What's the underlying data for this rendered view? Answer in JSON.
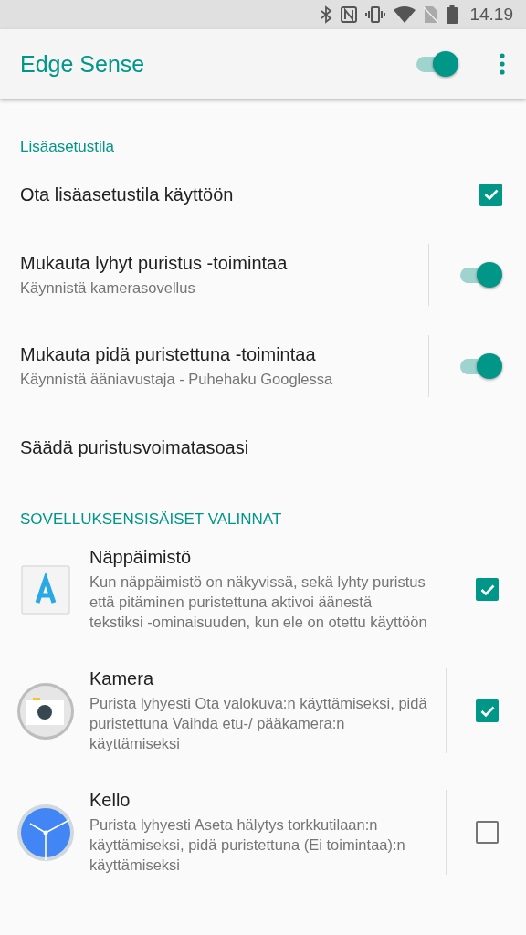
{
  "status_bar": {
    "time": "14.19"
  },
  "app_bar": {
    "title": "Edge Sense",
    "master_switch_on": true
  },
  "sections": [
    {
      "title": "Lisäasetustila",
      "items": [
        {
          "kind": "checkbox",
          "title": "Ota lisäasetustila käyttöön",
          "checked": true
        },
        {
          "kind": "switch",
          "title": "Mukauta lyhyt puristus -toimintaa",
          "subtitle": "Käynnistä kamerasovellus",
          "on": true
        },
        {
          "kind": "switch",
          "title": "Mukauta pidä puristettuna -toimintaa",
          "subtitle": "Käynnistä ääniavustaja - Puhehaku Googlessa",
          "on": true
        },
        {
          "kind": "plain",
          "title": "Säädä puristusvoimatasoasi"
        }
      ]
    },
    {
      "title": "SOVELLUKSENSISÄISET VALINNAT",
      "items": [
        {
          "kind": "app",
          "title": "Näppäimistö",
          "subtitle": "Kun näppäimistö on näkyvissä, sekä lyhty puristus että pitäminen puristettuna aktivoi äänestä tekstiksi -ominaisuuden, kun ele on otettu käyttöön",
          "checked": true,
          "divider": false
        },
        {
          "kind": "app",
          "title": "Kamera",
          "subtitle": "Purista lyhyesti Ota valokuva:n käyttämiseksi, pidä puristettuna Vaihda etu-/ pääkamera:n käyttämiseksi",
          "checked": true,
          "divider": true
        },
        {
          "kind": "app",
          "title": "Kello",
          "subtitle": "Purista lyhyesti Aseta hälytys torkkutilaan:n käyttämiseksi, pidä puristettuna (Ei toimintaa):n käyttämiseksi",
          "checked": false,
          "divider": true
        }
      ]
    }
  ]
}
